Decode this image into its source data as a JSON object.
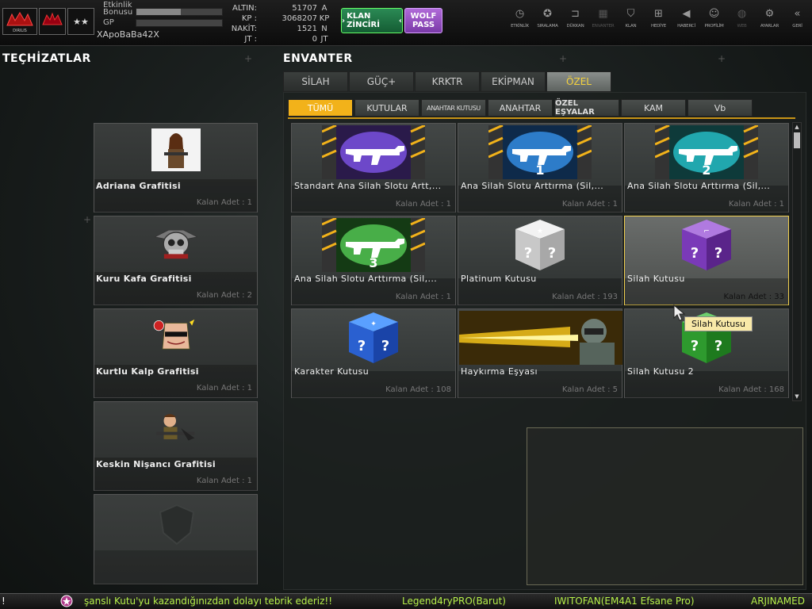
{
  "header": {
    "rank_logo_text": "WOLF",
    "clan_logo_text": "DIRILIS",
    "stars": "★★",
    "event_bonus_label": "Etkinlik Bonusu",
    "event_bonus_fraction": 0.52,
    "gp_label": "GP",
    "gp_fraction": 0.0,
    "username": "XApoBaBa42X",
    "currencies": [
      {
        "label": "ALTIN:",
        "value": "51707",
        "code": "A"
      },
      {
        "label": "KP :",
        "value": "3068207",
        "code": "KP"
      },
      {
        "label": "NAKİT:",
        "value": "1521",
        "code": "N"
      },
      {
        "label": "JT :",
        "value": "0",
        "code": "JT"
      }
    ],
    "klan_button": "KLAN ZİNCİRİ",
    "wolf_pass_line1": "WOLF",
    "wolf_pass_line2": "PASS",
    "nav": [
      {
        "label": "ETKİNLİK",
        "icon": "clock-icon",
        "glyph": "◷"
      },
      {
        "label": "SIRALAMA",
        "icon": "medal-icon",
        "glyph": "✪"
      },
      {
        "label": "DÜKKAN",
        "icon": "cart-icon",
        "glyph": "⊐"
      },
      {
        "label": "ENVANTER",
        "icon": "inventory-icon",
        "glyph": "▦"
      },
      {
        "label": "KLAN",
        "icon": "shield-icon",
        "glyph": "⛉"
      },
      {
        "label": "HEDİYE",
        "icon": "gift-icon",
        "glyph": "⊞"
      },
      {
        "label": "HABERCİ",
        "icon": "megaphone-icon",
        "glyph": "◀"
      },
      {
        "label": "PROFİLİM",
        "icon": "profile-icon",
        "glyph": "☺"
      },
      {
        "label": "WEB",
        "icon": "globe-icon",
        "glyph": "◍"
      },
      {
        "label": "AYARLAR",
        "icon": "gear-icon",
        "glyph": "⚙"
      },
      {
        "label": "GERİ",
        "icon": "back-icon",
        "glyph": "«"
      }
    ]
  },
  "equipment": {
    "title": "TEÇHİZATLAR",
    "items": [
      {
        "name": "Adriana Grafitisi",
        "count": "Kalan Adet : 1",
        "icon": "adriana-graffiti-icon"
      },
      {
        "name": "Kuru Kafa Grafitisi",
        "count": "Kalan Adet : 2",
        "icon": "skull-graffiti-icon"
      },
      {
        "name": "Kurtlu Kalp Grafitisi",
        "count": "Kalan Adet : 1",
        "icon": "wolf-heart-graffiti-icon"
      },
      {
        "name": "Keskin Nişancı Grafitisi",
        "count": "Kalan Adet : 1",
        "icon": "sniper-graffiti-icon"
      }
    ]
  },
  "inventory": {
    "title": "ENVANTER",
    "tabs": [
      "SİLAH",
      "GÜÇ+",
      "KRKTR",
      "EKİPMAN",
      "ÖZEL"
    ],
    "active_tab": "ÖZEL",
    "subtabs": [
      "TÜMÜ",
      "KUTULAR",
      "ANAHTAR KUTUSU",
      "ANAHTAR",
      "ÖZEL EŞYALAR",
      "KAM",
      "Vb"
    ],
    "active_subtab": "TÜMÜ",
    "items": [
      {
        "name": "Standart Ana Silah Slotu Artt,...",
        "count": "Kalan Adet : 1",
        "icon": "rifle-slot-purple-icon",
        "badge": ""
      },
      {
        "name": "Ana Silah Slotu Arttırma (Sil,...",
        "count": "Kalan Adet : 1",
        "icon": "rifle-slot-blue-icon",
        "badge": "1"
      },
      {
        "name": "Ana Silah Slotu Arttırma (Sil,...",
        "count": "Kalan Adet : 1",
        "icon": "rifle-slot-teal-icon",
        "badge": "2"
      },
      {
        "name": "Ana Silah Slotu Arttırma (Sil,...",
        "count": "Kalan Adet : 1",
        "icon": "rifle-slot-green-icon",
        "badge": "3"
      },
      {
        "name": "Platinum Kutusu",
        "count": "Kalan Adet : 193",
        "icon": "platinum-box-icon",
        "badge": ""
      },
      {
        "name": "Silah Kutusu",
        "count": "Kalan Adet : 33",
        "icon": "weapon-box-icon",
        "badge": ""
      },
      {
        "name": "Karakter Kutusu",
        "count": "Kalan Adet : 108",
        "icon": "character-box-icon",
        "badge": ""
      },
      {
        "name": "Haykırma Eşyası",
        "count": "Kalan Adet : 5",
        "icon": "shout-item-icon",
        "badge": ""
      },
      {
        "name": "Silah Kutusu 2",
        "count": "Kalan Adet : 168",
        "icon": "weapon-box-2-icon",
        "badge": ""
      }
    ],
    "tooltip": "Silah Kutusu"
  },
  "ticker": {
    "items": [
      "!",
      "şanslı Kutu'yu kazandığınızdan dolayı tebrik ederiz!!",
      "Legend4ryPRO(Barut)",
      "IWITOFAN(EM4A1 Efsane Pro)",
      "ARJINAMED"
    ]
  },
  "colors": {
    "accent": "#f2b21a",
    "ticker_text": "#b6f04a",
    "active_tab_text": "#f4d23d"
  }
}
